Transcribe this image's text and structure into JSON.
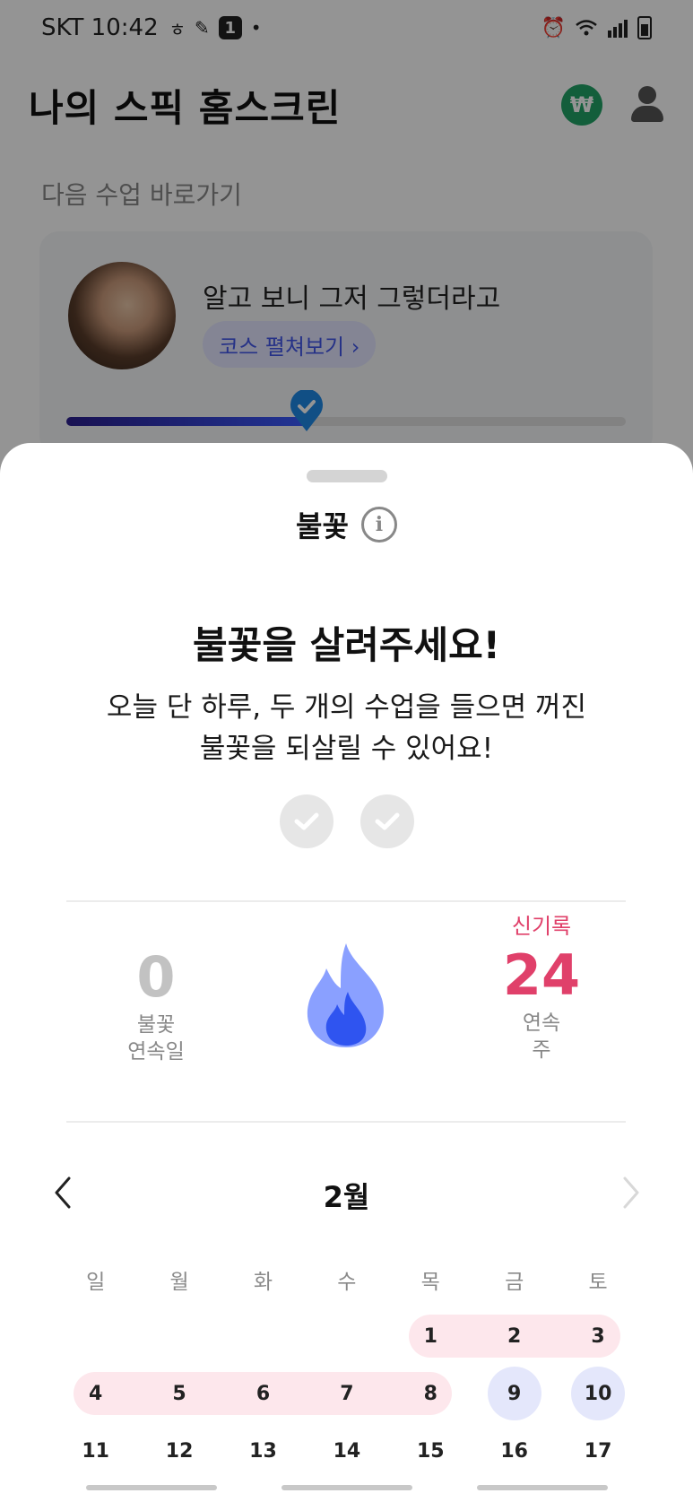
{
  "status_bar": {
    "carrier_time": "SKT 10:42",
    "notification_badge": "1"
  },
  "app": {
    "title": "나의 스픽 홈스크린",
    "won_icon": "₩",
    "next_class_label": "다음 수업 바로가기",
    "lesson_title": "알고 보니 그저 그렇더라고",
    "course_button": "코스 펼쳐보기 ›",
    "lesson_progress": 0.43
  },
  "sheet": {
    "title": "불꽃",
    "info_icon": "i",
    "revive_title": "불꽃을 살려주세요!",
    "revive_desc_line1": "오늘 단 하루, 두 개의 수업을 들으면 꺼진",
    "revive_desc_line2": "불꽃을 되살릴 수 있어요!",
    "required_lessons": 2,
    "completed_lessons": 0,
    "streak": {
      "value": "0",
      "caption_line1": "불꽃",
      "caption_line2": "연속일"
    },
    "weekly": {
      "badge": "신기록",
      "value": "24",
      "caption_line1": "연속",
      "caption_line2": "주"
    },
    "colors": {
      "accent_pink": "#e0406a",
      "flame_blue": "#3b5bff",
      "streak_band": "#fde7ec",
      "freeze_day": "#e4e7fb"
    },
    "calendar": {
      "month": "2월",
      "weekdays": [
        "일",
        "월",
        "화",
        "수",
        "목",
        "금",
        "토"
      ],
      "week1": [
        "1",
        "2",
        "3"
      ],
      "week2": [
        "4",
        "5",
        "6",
        "7",
        "8",
        "9",
        "10"
      ],
      "week3": [
        "11",
        "12",
        "13",
        "14",
        "15",
        "16",
        "17"
      ]
    }
  }
}
